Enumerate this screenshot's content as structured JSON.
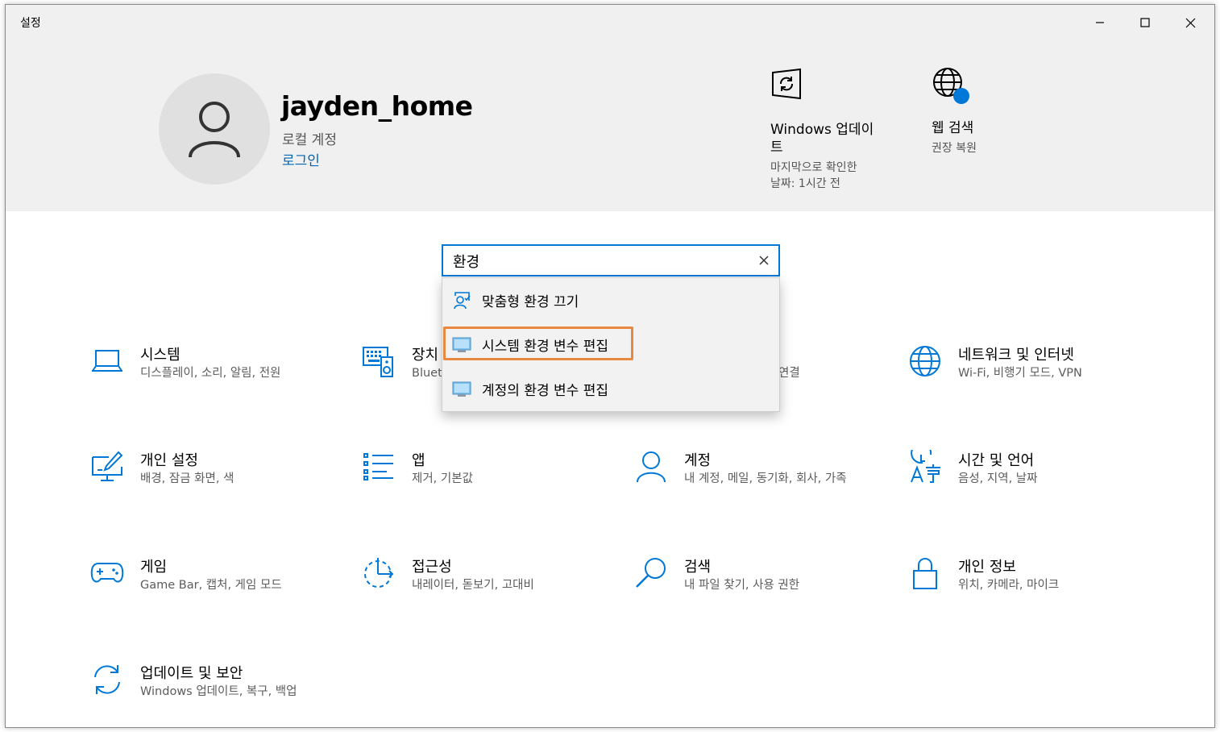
{
  "window": {
    "title": "설정"
  },
  "profile": {
    "name": "jayden_home",
    "account_type": "로컬 계정",
    "login_link": "로그인"
  },
  "quick_actions": [
    {
      "title": "Windows 업데이\n트",
      "subtitle": "마지막으로 확인한\n날짜: 1시간 전",
      "icon": "windows-update-icon"
    },
    {
      "title": "웹 검색",
      "subtitle": "권장 복원",
      "icon": "globe-icon"
    }
  ],
  "search": {
    "value": "환경"
  },
  "suggestions": [
    {
      "label": "맞춤형 환경 끄기",
      "icon": "personalized-experience-icon"
    },
    {
      "label": "시스템 환경 변수 편집",
      "icon": "monitor-icon",
      "highlighted": true
    },
    {
      "label": "계정의 환경 변수 편집",
      "icon": "monitor-icon"
    }
  ],
  "categories": [
    {
      "id": "system",
      "title": "시스템",
      "subtitle": "디스플레이, 소리, 알림, 전원",
      "icon": "laptop-icon"
    },
    {
      "id": "devices",
      "title": "장치",
      "subtitle": "Bluet",
      "icon": "keyboard-speaker-icon"
    },
    {
      "id": "phone",
      "title": "",
      "subtitle": "연결",
      "icon": ""
    },
    {
      "id": "network",
      "title": "네트워크 및 인터넷",
      "subtitle": "Wi-Fi, 비행기 모드, VPN",
      "icon": "globe-icon"
    },
    {
      "id": "personalization",
      "title": "개인 설정",
      "subtitle": "배경, 잠금 화면, 색",
      "icon": "paint-monitor-icon"
    },
    {
      "id": "apps",
      "title": "앱",
      "subtitle": "제거, 기본값",
      "icon": "list-icon"
    },
    {
      "id": "accounts",
      "title": "계정",
      "subtitle": "내 계정, 메일, 동기화, 회사, 가족",
      "icon": "person-icon"
    },
    {
      "id": "time",
      "title": "시간 및 언어",
      "subtitle": "음성, 지역, 날짜",
      "icon": "time-language-icon"
    },
    {
      "id": "gaming",
      "title": "게임",
      "subtitle": "Game Bar, 캡처, 게임 모드",
      "icon": "gamepad-icon"
    },
    {
      "id": "ease",
      "title": "접근성",
      "subtitle": "내레이터, 돋보기, 고대비",
      "icon": "ease-of-access-icon"
    },
    {
      "id": "search",
      "title": "검색",
      "subtitle": "내 파일 찾기, 사용 권한",
      "icon": "magnifier-icon"
    },
    {
      "id": "privacy",
      "title": "개인 정보",
      "subtitle": "위치, 카메라, 마이크",
      "icon": "lock-icon"
    },
    {
      "id": "update",
      "title": "업데이트 및 보안",
      "subtitle": "Windows 업데이트, 복구, 백업",
      "icon": "sync-icon"
    }
  ],
  "colors": {
    "accent": "#0078d7",
    "link": "#0066b4",
    "highlight": "#e8893f",
    "header_bg": "#f0f0f0"
  }
}
